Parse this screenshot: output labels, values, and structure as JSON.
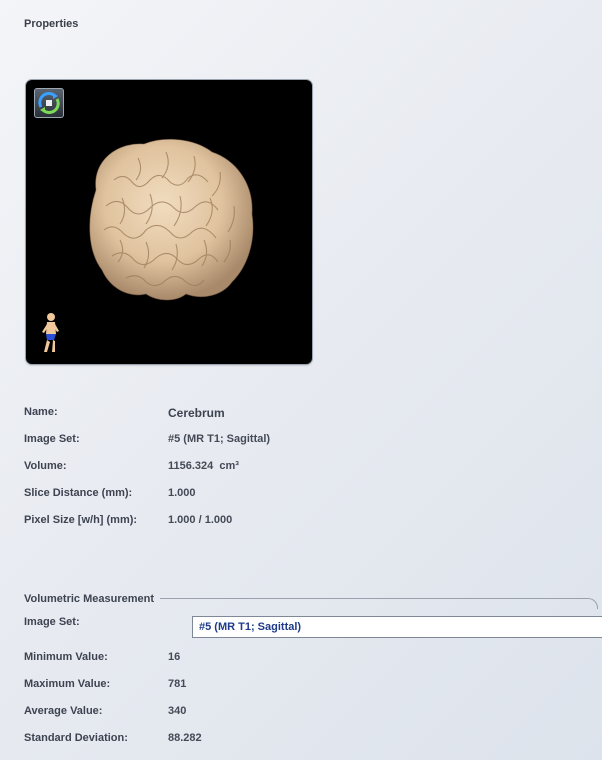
{
  "panel": {
    "title": "Properties"
  },
  "properties": [
    {
      "label": "Name:",
      "value": "Cerebrum"
    },
    {
      "label": "Image Set:",
      "value": "#5 (MR T1; Sagittal)"
    },
    {
      "label": "Volume:",
      "value": "1156.324  cm³"
    },
    {
      "label": "Slice Distance (mm):",
      "value": "1.000"
    },
    {
      "label": "Pixel Size [w/h] (mm):",
      "value": "1.000 / 1.000"
    }
  ],
  "volumetric": {
    "title": "Volumetric Measurement",
    "image_set_label": "Image Set:",
    "image_set_selected": "#5 (MR T1; Sagittal)",
    "stats": [
      {
        "label": "Minimum Value:",
        "value": "16"
      },
      {
        "label": "Maximum Value:",
        "value": "781"
      },
      {
        "label": "Average Value:",
        "value": "340"
      },
      {
        "label": "Standard Deviation:",
        "value": "88.282"
      }
    ]
  },
  "icons": {
    "rotate": "rotate-3d-icon",
    "orientation": "patient-orientation-icon",
    "dropdown": "chevron-down-icon"
  },
  "colors": {
    "viewer_bg": "#000000",
    "brain": "#e8cfae",
    "select_text": "#1f3a8a"
  }
}
